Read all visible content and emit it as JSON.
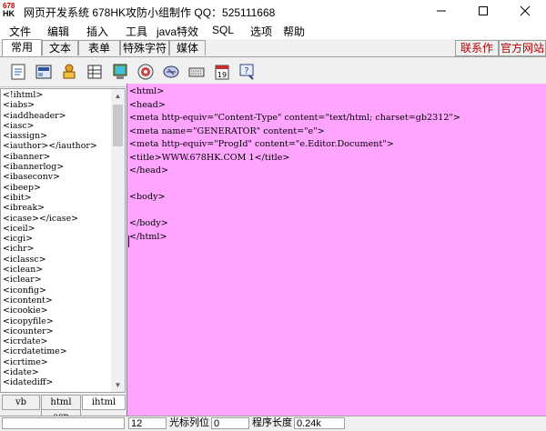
{
  "window": {
    "app_icon_lines": [
      "678",
      "HK"
    ],
    "title": "网页开发系统 678HK攻防小组制作 QQ：525111668",
    "minimize_glyph": "—",
    "maximize_glyph": "☐",
    "close_glyph": "✕"
  },
  "menu": [
    "文件",
    "编辑",
    "插入",
    "工具",
    "java特效",
    "SQL",
    "选项",
    "帮助"
  ],
  "tabs": [
    "常用",
    "文本",
    "表单",
    "特殊字符",
    "媒体"
  ],
  "right_links": [
    "联系作者",
    "官方网站"
  ],
  "toolbar_icons": [
    "html-page-icon",
    "frame-icon",
    "bookmark-icon",
    "table-icon",
    "image-icon",
    "media-icon",
    "script-icon",
    "keyboard-icon",
    "calendar-icon",
    "help-icon"
  ],
  "calendar_day": "19",
  "tag_list": [
    "<!ihtml>",
    "<iabs>",
    "<iaddheader>",
    "<iasc>",
    "<iassign>",
    "<iauthor></iauthor>",
    "<ibanner>",
    "<ibannerlog>",
    "<ibaseconv>",
    "<ibeep>",
    "<ibit>",
    "<ibreak>",
    "<icase></icase>",
    "<iceil>",
    "<icgi>",
    "<ichr>",
    "<iclassc>",
    "<iclean>",
    "<iclear>",
    "<iconfig>",
    "<icontent>",
    "<icookie>",
    "<icopyfile>",
    "<icounter>",
    "<icrdate>",
    "<icrdatetime>",
    "<icrtime>",
    "<idate>",
    "<idatediff>"
  ],
  "bottom_tabs": [
    "vb",
    "html",
    "ihtml",
    "asp"
  ],
  "code_lines": [
    "<html>",
    "<head>",
    "<meta http-equiv=\"Content-Type\" content=\"text/html; charset=gb2312\">",
    "<meta name=\"GENERATOR\" content=\"e\">",
    "<meta http-equiv=\"ProgId\" content=\"e.Editor.Document\">",
    "<title>WWW.678HK.COM 1</title>",
    "</head>",
    "",
    "<body>",
    "",
    "</body>",
    "</html>"
  ],
  "status": {
    "left_text": "",
    "line_count": "12",
    "cursor_label": "光标列位",
    "cursor_value": "0",
    "length_label": "程序长度",
    "length_value": "0.24k"
  }
}
